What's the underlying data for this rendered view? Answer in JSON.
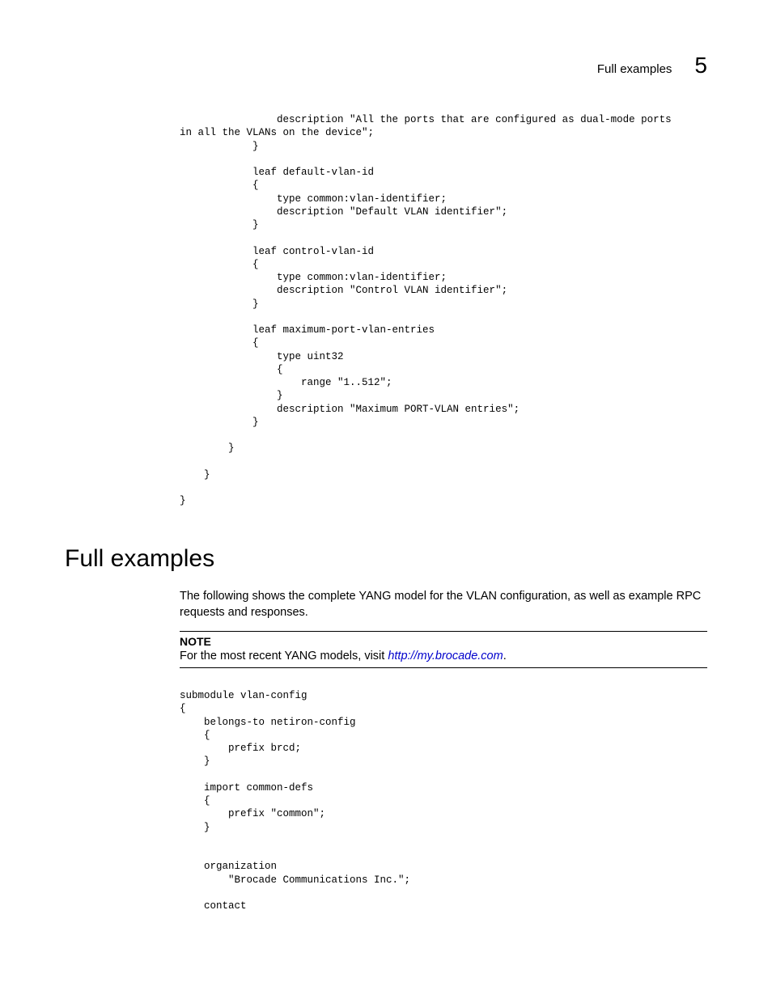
{
  "header": {
    "text": "Full examples",
    "chapter": "5"
  },
  "codeBlock1": "                description \"All the ports that are configured as dual-mode ports\nin all the VLANs on the device\";\n            }\n\n            leaf default-vlan-id\n            {\n                type common:vlan-identifier;\n                description \"Default VLAN identifier\";\n            }\n\n            leaf control-vlan-id\n            {\n                type common:vlan-identifier;\n                description \"Control VLAN identifier\";\n            }\n\n            leaf maximum-port-vlan-entries\n            {\n                type uint32\n                {\n                    range \"1..512\";\n                }\n                description \"Maximum PORT-VLAN entries\";\n            }\n\n        }\n\n    }\n\n}",
  "section": {
    "title": "Full examples",
    "intro": "The following shows the complete YANG model for the VLAN configuration, as well as example RPC requests and responses."
  },
  "note": {
    "label": "NOTE",
    "prefix": "For the most recent YANG models, visit ",
    "link": "http://my.brocade.com",
    "suffix": "."
  },
  "codeBlock2": "submodule vlan-config\n{\n    belongs-to netiron-config\n    {\n        prefix brcd;\n    }\n\n    import common-defs\n    {\n        prefix \"common\";\n    }\n\n\n    organization\n        \"Brocade Communications Inc.\";\n\n    contact"
}
